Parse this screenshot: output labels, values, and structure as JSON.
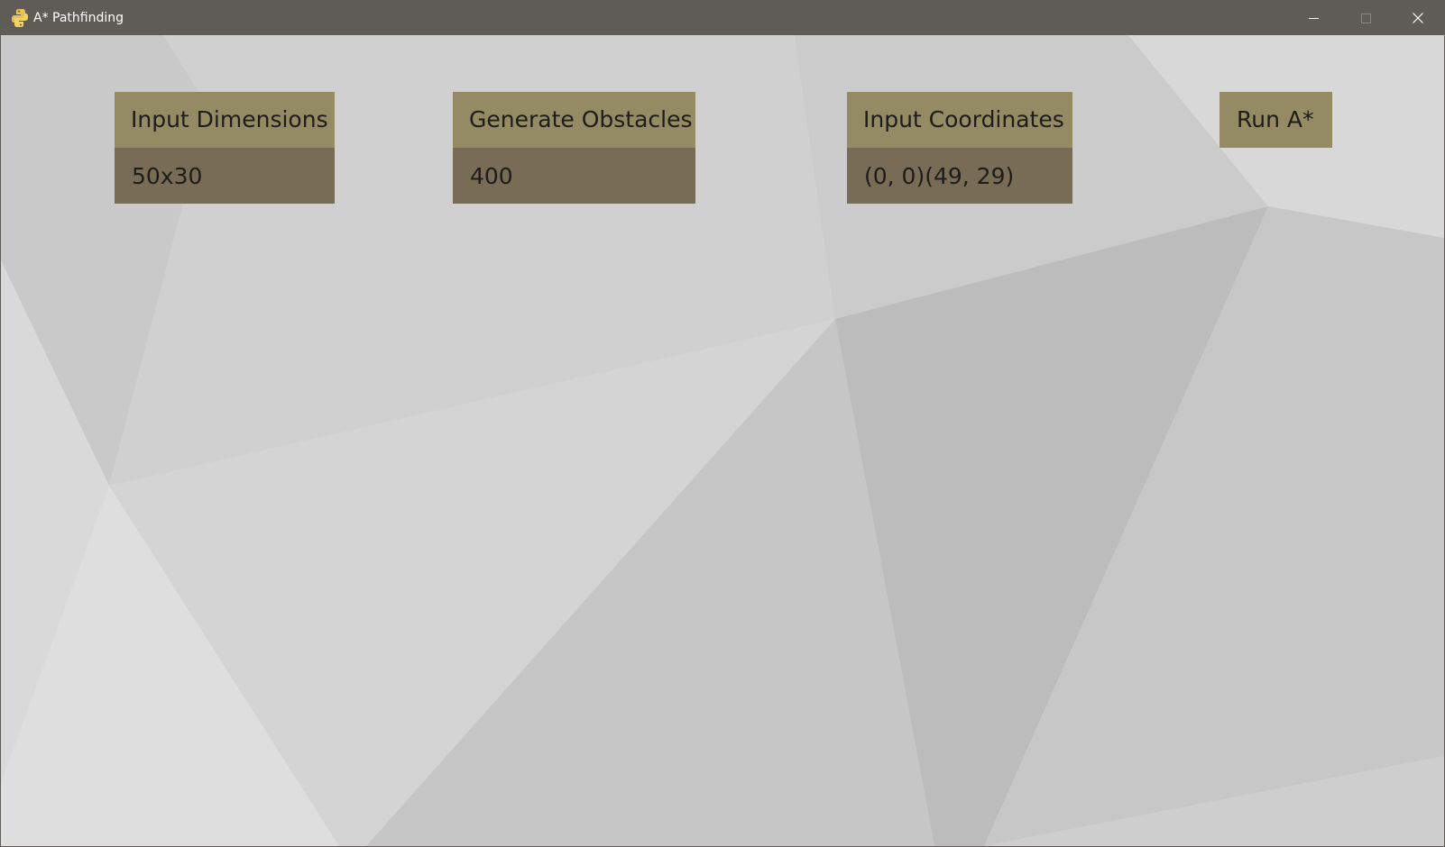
{
  "window": {
    "title": "A* Pathfinding",
    "app_icon": "python-icon",
    "controls": [
      "minimize-icon",
      "maximize-icon",
      "close-icon"
    ]
  },
  "panels": {
    "dimensions": {
      "label": "Input Dimensions",
      "value": "50x30"
    },
    "obstacles": {
      "label": "Generate Obstacles",
      "value": "400"
    },
    "coordinates": {
      "label": "Input Coordinates",
      "value": "(0, 0)(49, 29)"
    },
    "run": {
      "label": "Run A*"
    }
  },
  "colors": {
    "titlebar": "#5f5b56",
    "header_fill": "#948a63",
    "field_fill": "#786c56",
    "text": "#1e1d1a",
    "background": "#d2d2d2"
  }
}
